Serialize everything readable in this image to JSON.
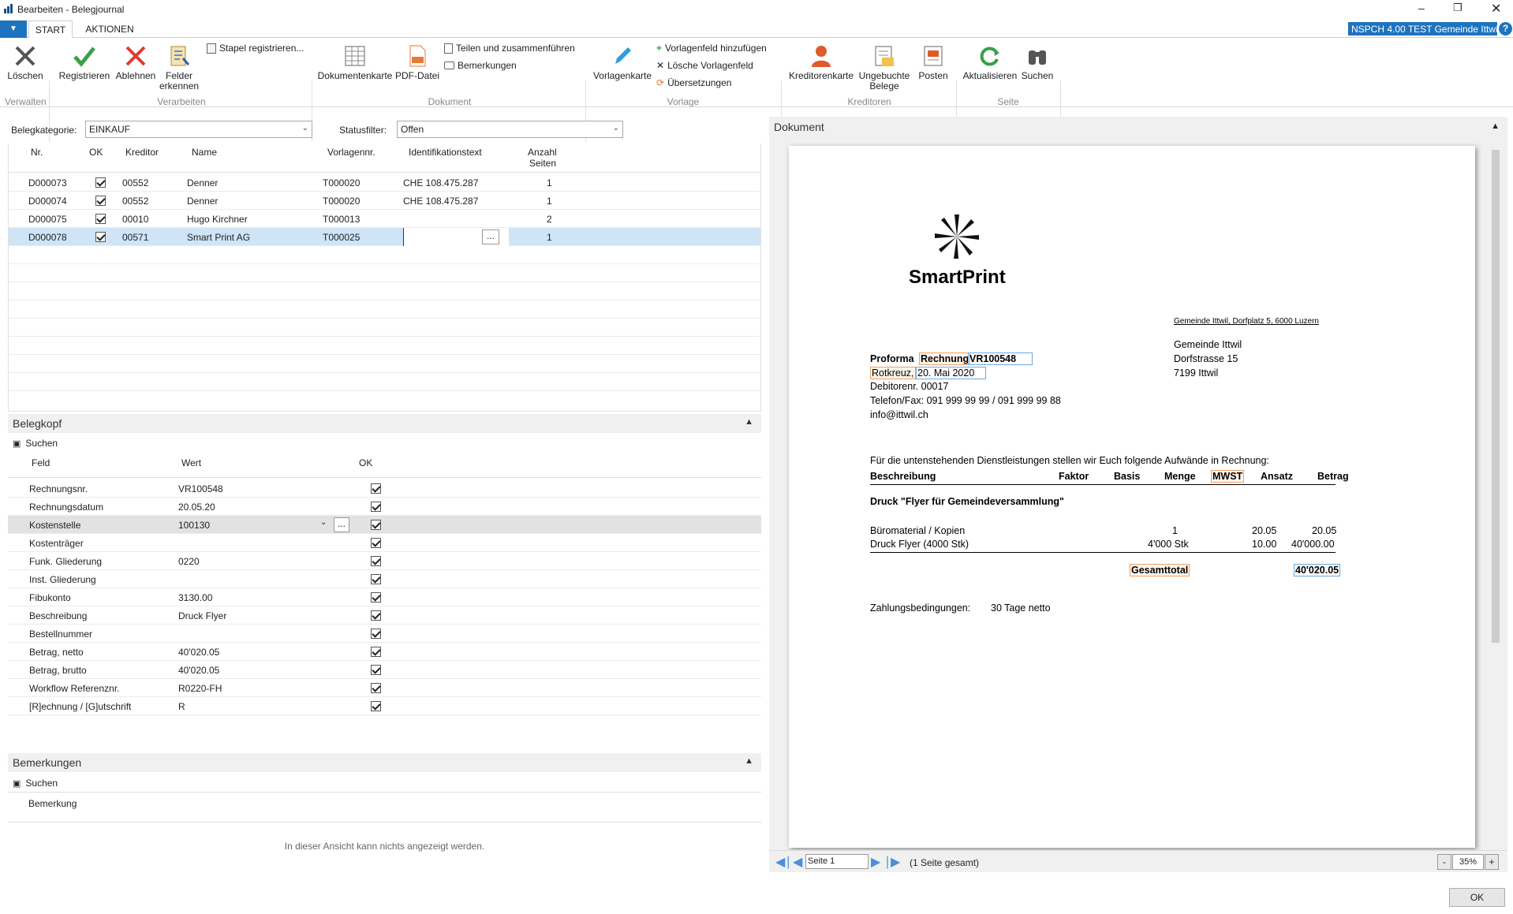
{
  "window": {
    "title": "Bearbeiten - Belegjournal",
    "company": "NSPCH  4.00 TEST Gemeinde Ittwil"
  },
  "tabs": [
    {
      "label": "START"
    },
    {
      "label": "AKTIONEN"
    }
  ],
  "ribbon": {
    "delete": "Löschen",
    "register": "Registrieren",
    "reject": "Ablehnen",
    "recognize": "Felder erkennen",
    "batch_register": "Stapel registrieren...",
    "document_card": "Dokumentenkarte",
    "pdf": "PDF-Datei",
    "split_merge": "Teilen und zusammenführen",
    "comments": "Bemerkungen",
    "template_card": "Vorlagenkarte",
    "add_template_field": "Vorlagenfeld hinzufügen",
    "delete_template_field": "Lösche Vorlagenfeld",
    "translations": "Übersetzungen",
    "vendor_card": "Kreditorenkarte",
    "unposted": "Ungebuchte Belege",
    "entries": "Posten",
    "refresh": "Aktualisieren",
    "search": "Suchen",
    "groups": {
      "manage": "Verwalten",
      "process": "Verarbeiten",
      "document": "Dokument",
      "template": "Vorlage",
      "vendors": "Kreditoren",
      "page": "Seite"
    }
  },
  "filters": {
    "category_label": "Belegkategorie:",
    "category_value": "EINKAUF",
    "status_label": "Statusfilter:",
    "status_value": "Offen"
  },
  "grid": {
    "headers": {
      "nr": "Nr.",
      "ok": "OK",
      "vendor": "Kreditor",
      "name": "Name",
      "template": "Vorlagennr.",
      "ident": "Identifikationstext",
      "pages1": "Anzahl",
      "pages2": "Seiten"
    },
    "rows": [
      {
        "nr": "D000073",
        "vendor": "00552",
        "name": "Denner",
        "template": "T000020",
        "ident": "CHE 108.475.287",
        "pages": "1"
      },
      {
        "nr": "D000074",
        "vendor": "00552",
        "name": "Denner",
        "template": "T000020",
        "ident": "CHE 108.475.287",
        "pages": "1"
      },
      {
        "nr": "D000075",
        "vendor": "00010",
        "name": "Hugo Kirchner",
        "template": "T000013",
        "ident": "",
        "pages": "2"
      },
      {
        "nr": "D000078",
        "vendor": "00571",
        "name": "Smart Print AG",
        "template": "T000025",
        "ident": "",
        "pages": "1"
      }
    ],
    "ellipsis": "..."
  },
  "belegkopf": {
    "title": "Belegkopf",
    "search": "Suchen",
    "headers": {
      "field": "Feld",
      "value": "Wert",
      "ok": "OK"
    },
    "rows": [
      {
        "field": "Rechnungsnr.",
        "value": "VR100548"
      },
      {
        "field": "Rechnungsdatum",
        "value": "20.05.20"
      },
      {
        "field": "Kostenstelle",
        "value": "100130"
      },
      {
        "field": "Kostenträger",
        "value": ""
      },
      {
        "field": "Funk. Gliederung",
        "value": "0220"
      },
      {
        "field": "Inst. Gliederung",
        "value": ""
      },
      {
        "field": "Fibukonto",
        "value": "3130.00"
      },
      {
        "field": "Beschreibung",
        "value": "Druck Flyer"
      },
      {
        "field": "Bestellnummer",
        "value": ""
      },
      {
        "field": "Betrag, netto",
        "value": "40'020.05"
      },
      {
        "field": "Betrag, brutto",
        "value": "40'020.05"
      },
      {
        "field": "Workflow Referenznr.",
        "value": "R0220-FH"
      },
      {
        "field": "[R]echnung / [G]utschrift",
        "value": "R"
      }
    ]
  },
  "bemerkungen": {
    "title": "Bemerkungen",
    "search": "Suchen",
    "header": "Bemerkung",
    "empty": "In dieser Ansicht kann nichts angezeigt werden."
  },
  "document": {
    "title": "Dokument",
    "logo": "SmartPrint",
    "sender_line": "Gemeinde Ittwil, Dorfplatz 5, 6000 Luzern",
    "recipient": [
      "Gemeinde Ittwil",
      "Dorfstrasse 15",
      "7199 Ittwil"
    ],
    "proforma": "Proforma",
    "rechnung": "Rechnung",
    "invoice_no": "VR100548",
    "place": "Rotkreuz,",
    "date": "20. Mai 2020",
    "debitor": "Debitorenr. 00017",
    "phone": "Telefon/Fax: 091 999 99 99 / 091 999 99 88",
    "email": "info@ittwil.ch",
    "intro": "Für die untenstehenden Dienstleistungen stellen wir Euch folgende Aufwände in Rechnung:",
    "cols": {
      "desc": "Beschreibung",
      "factor": "Faktor",
      "basis": "Basis",
      "qty": "Menge",
      "vat": "MWST",
      "rate": "Ansatz",
      "amount": "Betrag"
    },
    "section": "Druck \"Flyer für Gemeindeversammlung\"",
    "lines": [
      {
        "desc": "Büromaterial / Kopien",
        "qty": "1",
        "rate": "20.05",
        "amount": "20.05"
      },
      {
        "desc": "Druck Flyer (4000 Stk)",
        "qty": "4'000 Stk",
        "rate": "10.00",
        "amount": "40'000.00"
      }
    ],
    "total_label": "Gesamttotal",
    "total": "40'020.05",
    "terms_label": "Zahlungsbedingungen:",
    "terms": "30 Tage netto"
  },
  "pager": {
    "page": "Seite 1",
    "total": "(1 Seite gesamt)",
    "zoom": "35%",
    "minus": "-",
    "plus": "+"
  },
  "footer": {
    "ok": "OK"
  }
}
